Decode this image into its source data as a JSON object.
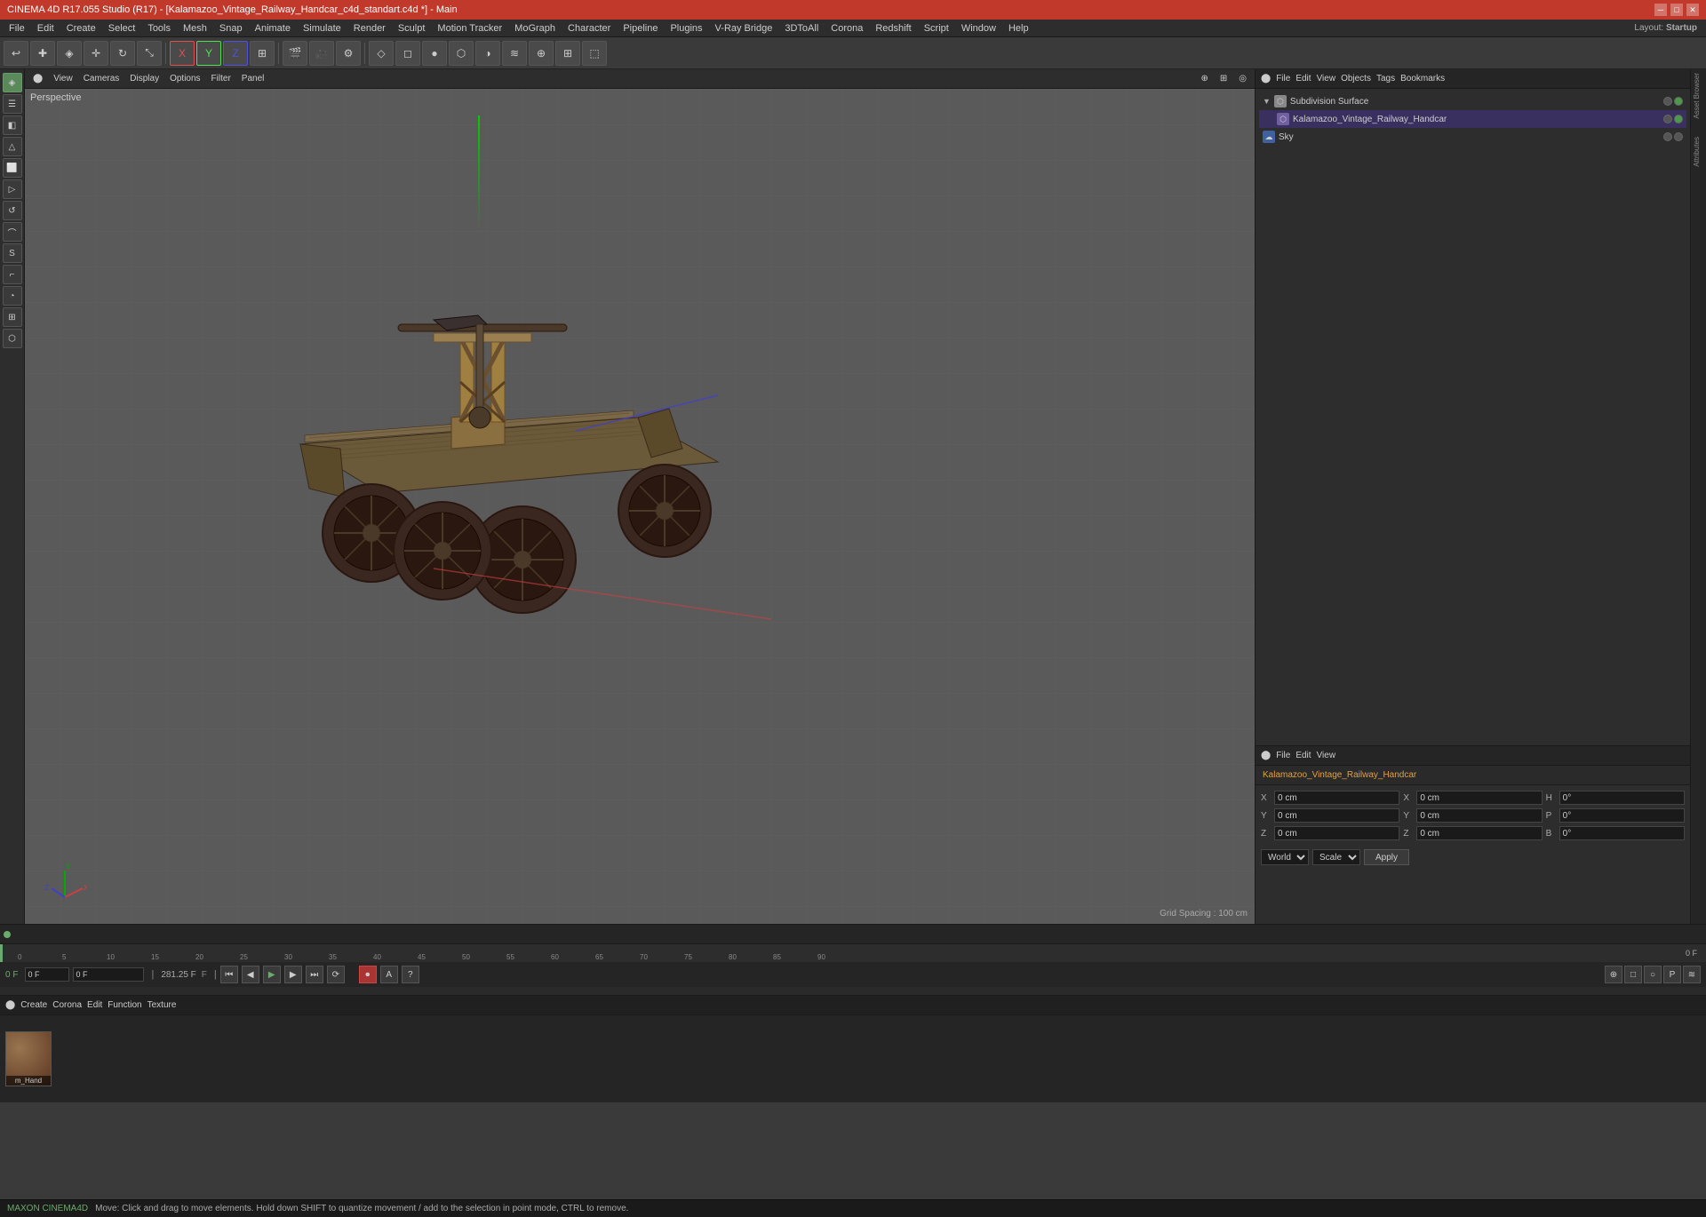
{
  "titlebar": {
    "title": "CINEMA 4D R17.055 Studio (R17) - [Kalamazoo_Vintage_Railway_Handcar_c4d_standart.c4d *] - Main"
  },
  "menubar": {
    "items": [
      "File",
      "Edit",
      "Create",
      "Select",
      "Tools",
      "Mesh",
      "Snap",
      "Animate",
      "Simulate",
      "Render",
      "Sculpt",
      "Motion Tracker",
      "MoGraph",
      "Character",
      "Pipeline",
      "Plugins",
      "V-Ray Bridge",
      "3DToAll",
      "Corona",
      "Redshift",
      "Script",
      "Window",
      "Help"
    ],
    "layout_label": "Layout:",
    "layout_value": "Startup"
  },
  "viewport": {
    "label": "Perspective",
    "toolbar": [
      "View",
      "Cameras",
      "Display",
      "Options",
      "Filter",
      "Panel"
    ],
    "grid_spacing": "Grid Spacing : 100 cm"
  },
  "object_manager": {
    "menu_items": [
      "File",
      "Edit",
      "View",
      "Objects",
      "Tags",
      "Bookmarks"
    ],
    "objects": [
      {
        "name": "Subdivision Surface",
        "indent": 0,
        "icon": "cube",
        "color": "white",
        "dot1": "gray",
        "dot2": "green"
      },
      {
        "name": "Kalamazoo_Vintage_Railway_Handcar",
        "indent": 1,
        "icon": "mesh",
        "color": "purple",
        "dot1": "gray",
        "dot2": "green"
      },
      {
        "name": "Sky",
        "indent": 0,
        "icon": "sky",
        "color": "blue",
        "dot1": "gray",
        "dot2": "gray"
      }
    ]
  },
  "attributes": {
    "menu_items": [
      "File",
      "Edit",
      "View"
    ],
    "selected_object": "Kalamazoo_Vintage_Railway_Handcar",
    "fields": [
      {
        "label": "X",
        "value": "0 cm",
        "secondary_label": "X",
        "secondary_value": "0 cm",
        "tertiary_label": "H",
        "tertiary_value": "0°"
      },
      {
        "label": "Y",
        "value": "0 cm",
        "secondary_label": "Y",
        "secondary_value": "0 cm",
        "tertiary_label": "P",
        "tertiary_value": "0°"
      },
      {
        "label": "Z",
        "value": "0 cm",
        "secondary_label": "Z",
        "secondary_value": "0 cm",
        "tertiary_label": "B",
        "tertiary_value": "0°"
      }
    ],
    "coord_system": "World",
    "transform_mode": "Scale",
    "apply_btn": "Apply"
  },
  "timeline": {
    "frame_start": "0 F",
    "frame_current": "0 F",
    "frame_end": "90",
    "tick_values": [
      "0",
      "5",
      "10",
      "15",
      "20",
      "25",
      "30",
      "35",
      "40",
      "45",
      "50",
      "55",
      "60",
      "65",
      "70",
      "75",
      "80",
      "85",
      "90"
    ],
    "fps_display": "281.25 F"
  },
  "transport": {
    "current_frame": "0 F",
    "frame_input": "0 F",
    "fps_value": "281.25 F"
  },
  "material_manager": {
    "menu_items": [
      "Create",
      "Corona",
      "Edit",
      "Function",
      "Texture"
    ],
    "materials": [
      {
        "name": "m_Hand",
        "color": "#7a5530"
      }
    ]
  },
  "status_bar": {
    "message": "Move: Click and drag to move elements. Hold down SHIFT to quantize movement / add to the selection in point mode, CTRL to remove."
  },
  "right_edge_tabs": [
    "Asset Browser",
    "Attributes"
  ]
}
